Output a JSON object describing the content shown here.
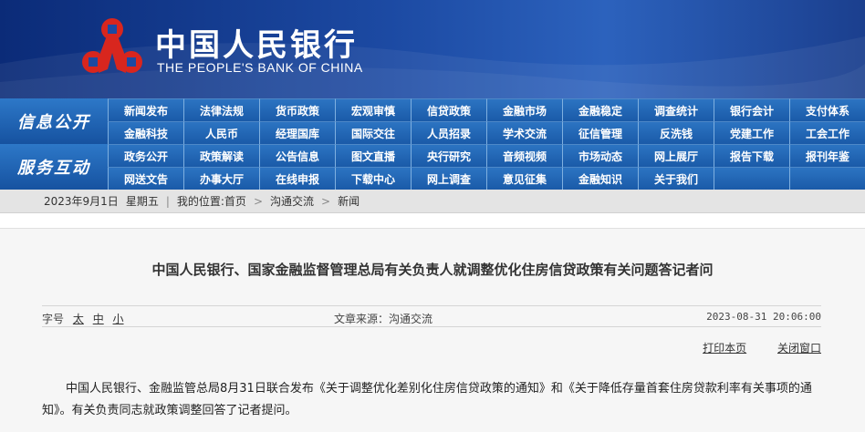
{
  "brand": {
    "name_cn": "中国人民银行",
    "name_en": "THE PEOPLE'S BANK OF CHINA"
  },
  "nav": {
    "section1_title": "信息公开",
    "section1_items": [
      "新闻发布",
      "法律法规",
      "货币政策",
      "宏观审慎",
      "信贷政策",
      "金融市场",
      "金融稳定",
      "调查统计",
      "银行会计",
      "支付体系",
      "金融科技",
      "人民币",
      "经理国库",
      "国际交往",
      "人员招录",
      "学术交流",
      "征信管理",
      "反洗钱",
      "党建工作",
      "工会工作"
    ],
    "section2_title": "服务互动",
    "section2_items": [
      "政务公开",
      "政策解读",
      "公告信息",
      "图文直播",
      "央行研究",
      "音频视频",
      "市场动态",
      "网上展厅",
      "报告下载",
      "报刊年鉴",
      "网送文告",
      "办事大厅",
      "在线申报",
      "下载中心",
      "网上调查",
      "意见征集",
      "金融知识",
      "关于我们",
      "",
      ""
    ]
  },
  "breadcrumb": {
    "date": "2023年9月1日",
    "weekday": "星期五",
    "location_label": "我的位置:",
    "home": "首页",
    "level1": "沟通交流",
    "level2": "新闻"
  },
  "article": {
    "title": "中国人民银行、国家金融监督管理总局有关负责人就调整优化住房信贷政策有关问题答记者问",
    "font_label": "字号",
    "font_large": "太",
    "font_medium": "中",
    "font_small": "小",
    "source": "文章来源：沟通交流",
    "datetime": "2023-08-31 20:06:00",
    "print_label": "打印本页",
    "close_label": "关闭窗口",
    "body": "中国人民银行、金融监管总局8月31日联合发布《关于调整优化差别化住房信贷政策的通知》和《关于降低存量首套住房贷款利率有关事项的通知》。有关负责同志就政策调整回答了记者提问。"
  },
  "colors": {
    "banner": "#1c4aa3",
    "nav": "#1a5aa8",
    "logo_red": "#d8261e"
  }
}
